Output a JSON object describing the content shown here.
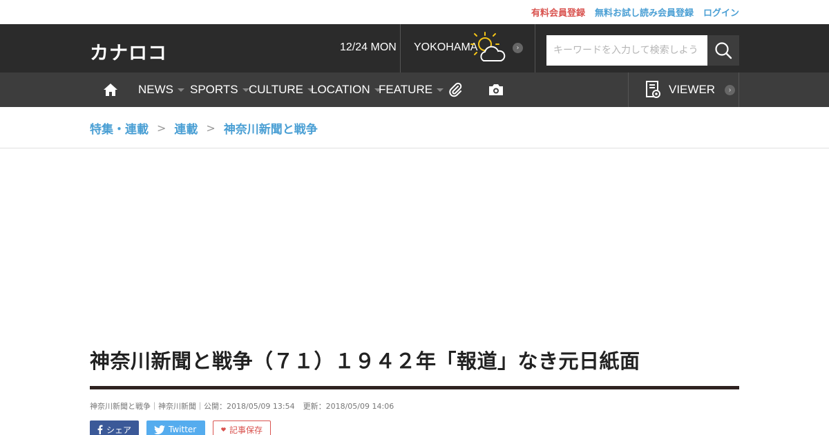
{
  "topbar": {
    "paid_signup": "有料会員登録",
    "trial_signup": "無料お試し読み会員登録",
    "login": "ログイン"
  },
  "header": {
    "logo": "カナロコ",
    "date": "12/24 MON",
    "city": "YOKOHAMA",
    "weather_icon": "sun-behind-cloud-icon",
    "search_placeholder": "キーワードを入力して検索しよう"
  },
  "nav": {
    "items": [
      {
        "label": "NEWS"
      },
      {
        "label": "SPORTS"
      },
      {
        "label": "CULTURE"
      },
      {
        "label": "LOCATION"
      },
      {
        "label": "FEATURE"
      }
    ],
    "viewer_label": "VIEWER"
  },
  "breadcrumb": {
    "items": [
      "特集・連載",
      "連載",
      "神奈川新聞と戦争"
    ],
    "separator": ">"
  },
  "article": {
    "title": "神奈川新聞と戦争（７１）１９４２年「報道」なき元日紙面",
    "source": "神奈川新聞と戦争｜神奈川新聞｜公開：2018/05/09 13:54",
    "updated": "更新：2018/05/09 14:06",
    "share_facebook": "シェア",
    "share_twitter": "Twitter",
    "save": "記事保存"
  },
  "colors": {
    "header_bg": "#2b2b2b",
    "nav_bg": "#3d3d3d",
    "link_blue": "#4a9fd4",
    "paid_red": "#d9534f",
    "facebook": "#3b5998",
    "twitter": "#55acee"
  }
}
